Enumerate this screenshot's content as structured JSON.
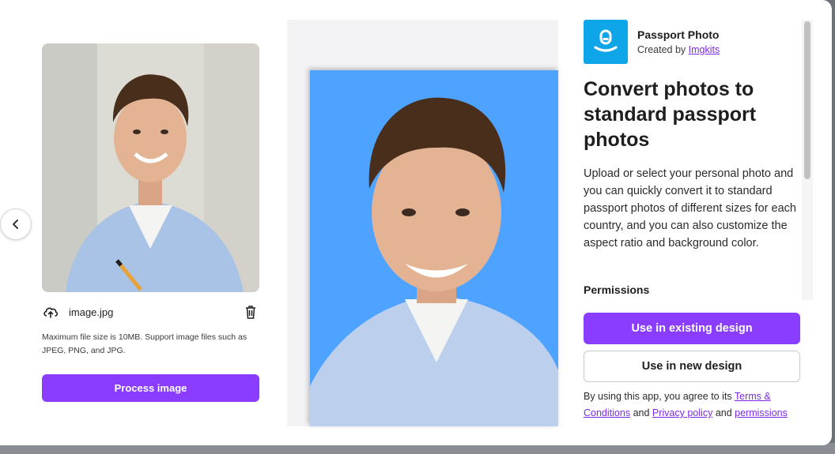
{
  "upload": {
    "file_name": "image.jpg",
    "hint": "Maximum file size is 10MB. Support image files such as JPEG, PNG, and JPG.",
    "process_label": "Process image"
  },
  "app": {
    "name": "Passport Photo",
    "created_by_prefix": "Created by",
    "creator": "Imgkits",
    "brand_color": "#0ea5e9"
  },
  "details": {
    "headline": "Convert photos to standard passport photos",
    "description": "Upload or select your personal photo and you can quickly convert it to standard passport photos of different sizes for each country, and you can also customize the aspect ratio and background color.",
    "permissions_title": "Permissions"
  },
  "actions": {
    "existing_label": "Use in existing design",
    "new_label": "Use in new design",
    "accent": "#8b3dff"
  },
  "legal": {
    "prefix": "By using this app, you agree to its",
    "terms": "Terms & Conditions",
    "and1": "and",
    "privacy": "Privacy policy",
    "and2": "and",
    "permissions": "permissions"
  },
  "preview": {
    "background_color": "#4da3ff"
  }
}
